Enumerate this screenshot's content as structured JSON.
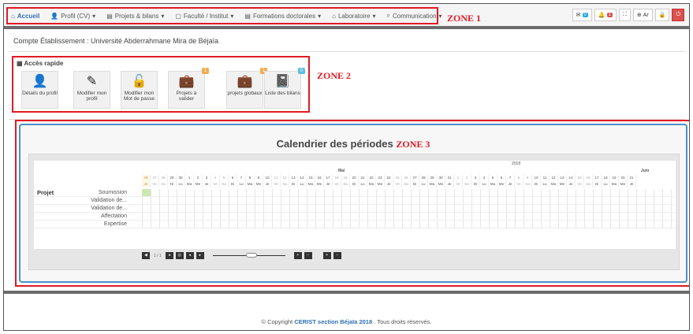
{
  "nav": {
    "items": [
      {
        "label": "Accueil",
        "icon": "home-icon",
        "glyph": "⌂",
        "active": true
      },
      {
        "label": "Profil (CV)",
        "icon": "user-icon",
        "glyph": "👤",
        "caret": "▾"
      },
      {
        "label": "Projets & bilans",
        "icon": "folder-icon",
        "glyph": "▤",
        "caret": "▾"
      },
      {
        "label": "Faculté / Institut",
        "icon": "building-icon",
        "glyph": "▢",
        "caret": "▾"
      },
      {
        "label": "Formations doctorales",
        "icon": "list-icon",
        "glyph": "▤",
        "caret": "▾"
      },
      {
        "label": "Laboratoire",
        "icon": "institution-icon",
        "glyph": "⌂",
        "caret": "▾"
      },
      {
        "label": "Communication",
        "icon": "chat-icon",
        "glyph": "⌕",
        "caret": "▾"
      }
    ],
    "right": {
      "mail_badge": "0",
      "bell_badge": "1",
      "lang": "Ar"
    }
  },
  "zones": {
    "z1": "ZONE 1",
    "z2": "ZONE 2",
    "z3": "ZONE 3"
  },
  "account_title": "Compte Établissement : Université Abderrahmane Mira de Béjaïa",
  "quick_access": {
    "title": "Accès rapide",
    "tiles": [
      {
        "label": "Détails du profil",
        "icon": "user-icon",
        "glyph": "👤"
      },
      {
        "label": "Modifier mon profil",
        "icon": "pencil-icon",
        "glyph": "✎"
      },
      {
        "label": "Modifier mon Mot de passe",
        "icon": "unlock-icon",
        "glyph": "🔓"
      },
      {
        "label": "Projets à valider",
        "icon": "briefcase-icon",
        "glyph": "💼",
        "badge": "1",
        "badge_color": "orange"
      },
      {
        "label": "projets globaux",
        "icon": "briefcase-icon",
        "glyph": "💼",
        "badge": "1",
        "badge_color": "orange"
      },
      {
        "label": "Liste des bilans",
        "icon": "book-icon",
        "glyph": "📓",
        "badge": "0",
        "badge_color": "blue"
      }
    ]
  },
  "calendar": {
    "title": "Calendrier des périodes",
    "year": "2018",
    "months": [
      {
        "label": "Mai"
      },
      {
        "label": "Juin"
      }
    ],
    "day_numbers": [
      "26",
      "27",
      "28",
      "29",
      "30",
      "1",
      "2",
      "3",
      "4",
      "5",
      "6",
      "7",
      "8",
      "9",
      "10",
      "11",
      "12",
      "13",
      "14",
      "15",
      "16",
      "17",
      "18",
      "19",
      "20",
      "21",
      "22",
      "23",
      "24",
      "25",
      "26",
      "27",
      "28",
      "29",
      "30",
      "31",
      "1",
      "2",
      "3",
      "4",
      "5",
      "6",
      "7",
      "8",
      "9",
      "10",
      "11",
      "12",
      "13",
      "14",
      "15",
      "16",
      "17",
      "18",
      "19",
      "20",
      "21"
    ],
    "day_names": [
      "Je",
      "Ve",
      "Sa",
      "Di",
      "Lu",
      "Ma",
      "Me",
      "Je",
      "Ve",
      "Sa",
      "Di",
      "Lu",
      "Ma",
      "Me",
      "Je",
      "Ve",
      "Sa",
      "Di",
      "Lu",
      "Ma",
      "Me",
      "Je",
      "Ve",
      "Sa",
      "Di",
      "Lu",
      "Ma",
      "Me",
      "Je",
      "Ve",
      "Sa",
      "Di",
      "Lu",
      "Ma",
      "Me",
      "Je",
      "Ve",
      "Sa",
      "Di",
      "Lu",
      "Ma",
      "Me",
      "Je",
      "Ve",
      "Sa",
      "Di",
      "Lu",
      "Ma",
      "Me",
      "Je",
      "Ve",
      "Sa",
      "Di",
      "Lu",
      "Ma",
      "Me",
      "Je"
    ],
    "group": "Projet",
    "tasks": [
      "Soumission",
      "Validation de...",
      "Validation de...",
      "Affectation",
      "Expertise"
    ],
    "page_indicator": "1 / 1"
  },
  "footer": {
    "prefix": "© Copyright ",
    "org": "CERIST section Béjaïa 2018",
    "suffix": " . Tous droits réservés."
  }
}
